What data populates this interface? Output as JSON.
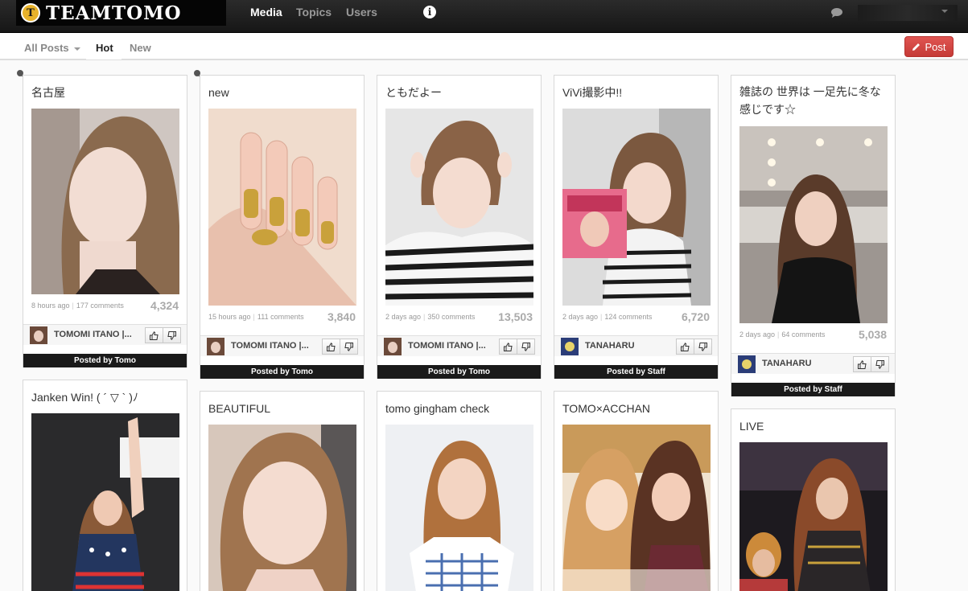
{
  "brand": {
    "logo_letter": "T",
    "logo_text": "TEAMTOMO"
  },
  "nav": {
    "media": "Media",
    "topics": "Topics",
    "users": "Users",
    "info_glyph": "i"
  },
  "subnav": {
    "all_posts": "All Posts",
    "hot": "Hot",
    "new": "New",
    "post_button": "Post"
  },
  "icons": {
    "info": "info-icon",
    "chat": "chat-bubble-icon",
    "pencil": "pencil-icon",
    "thumb_up": "thumb-up-icon",
    "thumb_down": "thumb-down-icon",
    "pin": "pin-icon"
  },
  "colors": {
    "accent_red": "#d9453f",
    "nav_bg": "#1f1f1f"
  },
  "cards": [
    {
      "title": "名古屋",
      "time": "8 hours ago",
      "comments": "177 comments",
      "score": "4,324",
      "author": "TOMOMI ITANO |...",
      "posted_by": "Posted by Tomo"
    },
    {
      "title": "new",
      "time": "15 hours ago",
      "comments": "111 comments",
      "score": "3,840",
      "author": "TOMOMI ITANO |...",
      "posted_by": "Posted by Tomo"
    },
    {
      "title": "ともだよー",
      "time": "2 days ago",
      "comments": "350 comments",
      "score": "13,503",
      "author": "TOMOMI ITANO |...",
      "posted_by": "Posted by Tomo"
    },
    {
      "title": "ViVi撮影中!!",
      "time": "2 days ago",
      "comments": "124 comments",
      "score": "6,720",
      "author": "TANAHARU",
      "posted_by": "Posted by Staff"
    },
    {
      "title": "雑誌の 世界は 一足先に冬な感じです☆",
      "time": "2 days ago",
      "comments": "64 comments",
      "score": "5,038",
      "author": "TANAHARU",
      "posted_by": "Posted by Staff"
    },
    {
      "title": "Janken Win! ( ´ ▽ ` )ﾉ"
    },
    {
      "title": "BEAUTIFUL"
    },
    {
      "title": "tomo gingham check"
    },
    {
      "title": "TOMO×ACCHAN"
    },
    {
      "title": "LIVE"
    }
  ]
}
